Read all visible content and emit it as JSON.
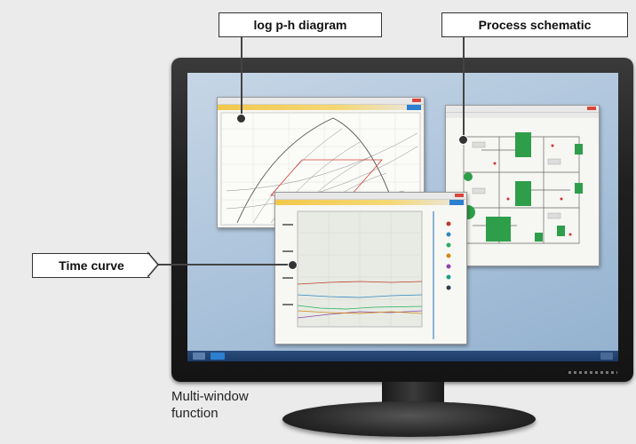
{
  "callouts": {
    "log_ph": "log p-h diagram",
    "process": "Process schematic",
    "time_curve": "Time curve"
  },
  "caption": {
    "line1": "Multi-window",
    "line2": "function"
  },
  "colors": {
    "toolbar_accent": "#f2c84b",
    "schematic_green": "#2e9e4a",
    "logo_blue": "#2d7fd0",
    "close_red": "#d9463b"
  }
}
